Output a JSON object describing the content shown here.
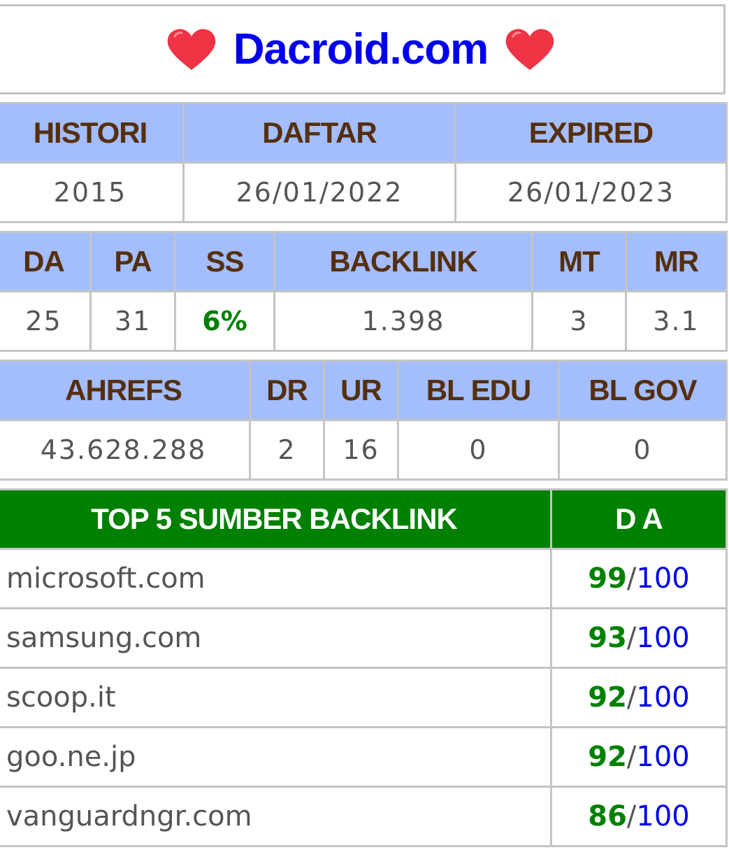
{
  "title": "Dacroid.com",
  "icons": {
    "left": "heart-icon",
    "right": "heart-icon"
  },
  "colors": {
    "header_bg": "#a4bdfc",
    "header_text": "#552f0f",
    "green": "#008000",
    "blue": "#0000ee"
  },
  "domain_info": {
    "headers": [
      "HISTORI",
      "DAFTAR",
      "EXPIRED"
    ],
    "values": [
      "2015",
      "26/01/2022",
      "26/01/2023"
    ]
  },
  "moz": {
    "headers": [
      "DA",
      "PA",
      "SS",
      "BACKLINK",
      "MT",
      "MR"
    ],
    "values": [
      "25",
      "31",
      "6%",
      "1.398",
      "3",
      "3.1"
    ]
  },
  "ahrefs": {
    "headers": [
      "AHREFS",
      "DR",
      "UR",
      "BL EDU",
      "BL GOV"
    ],
    "values": [
      "43.628.288",
      "2",
      "16",
      "0",
      "0"
    ]
  },
  "backlinks": {
    "header_source": "TOP 5 SUMBER BACKLINK",
    "header_da": "D A",
    "rows": [
      {
        "site": "microsoft.com",
        "da": "99",
        "max": "100"
      },
      {
        "site": "samsung.com",
        "da": "93",
        "max": "100"
      },
      {
        "site": "scoop.it",
        "da": "92",
        "max": "100"
      },
      {
        "site": "goo.ne.jp",
        "da": "92",
        "max": "100"
      },
      {
        "site": "vanguardngr.com",
        "da": "86",
        "max": "100"
      }
    ],
    "separator": "/"
  }
}
